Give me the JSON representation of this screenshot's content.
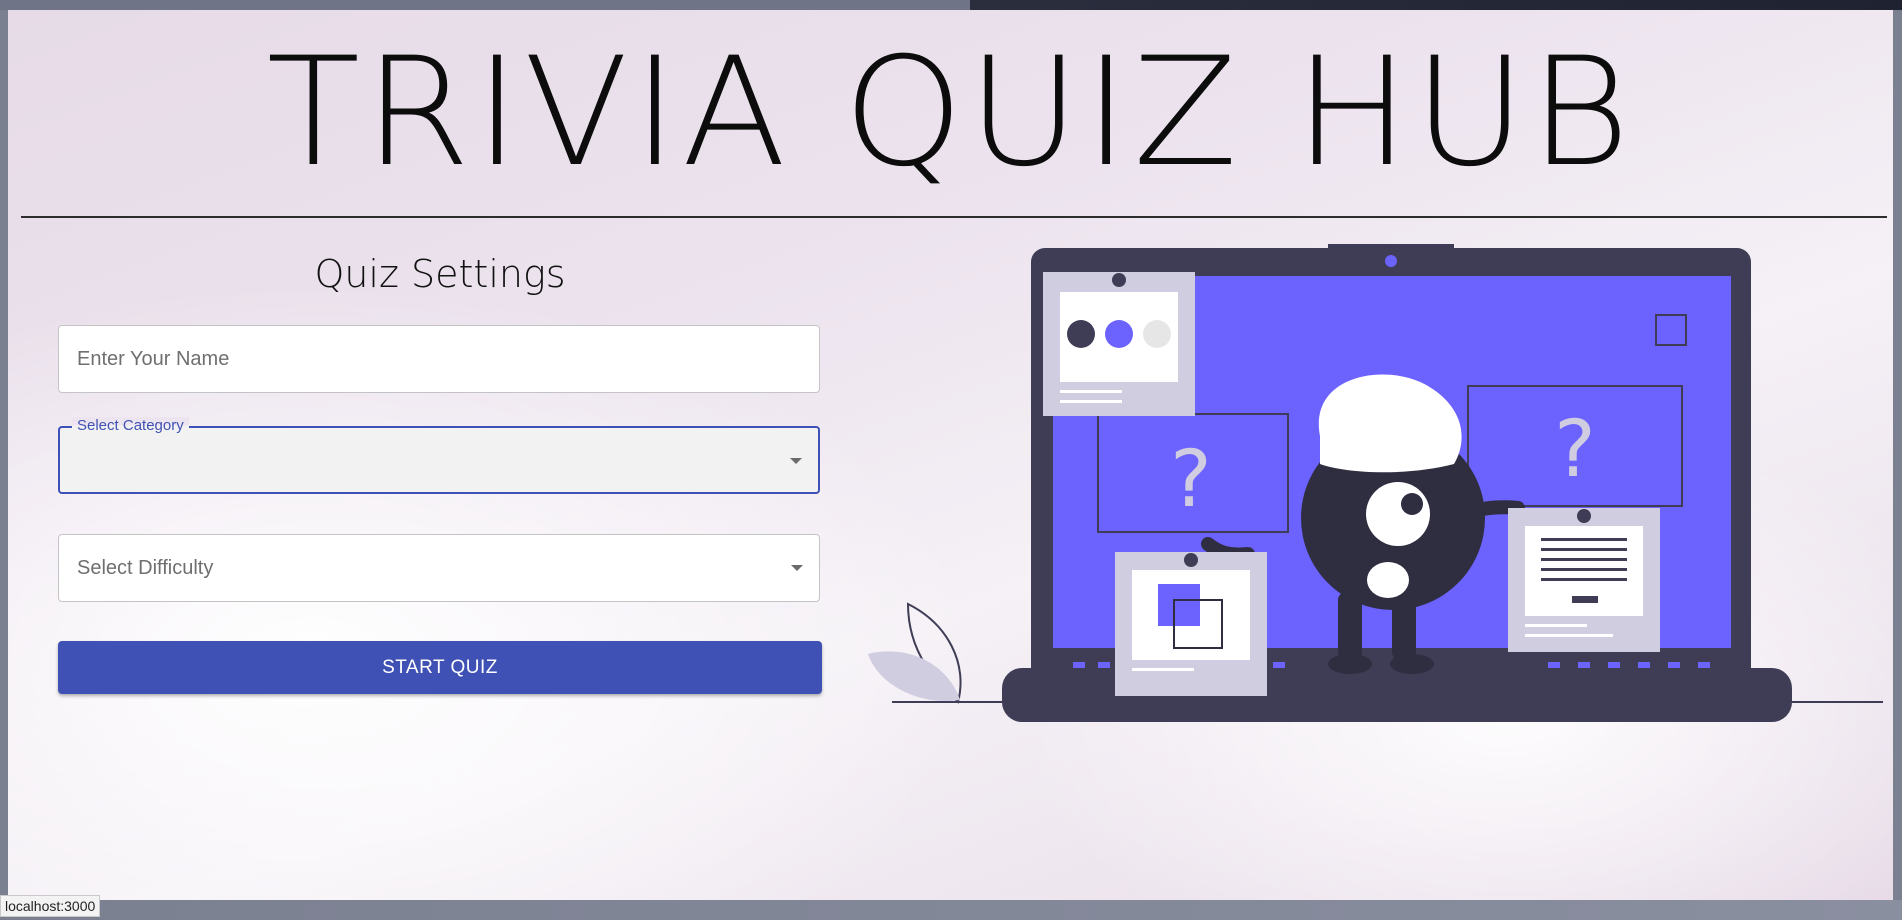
{
  "app": {
    "title": "TRIVIA QUIZ HUB"
  },
  "settings": {
    "heading": "Quiz Settings",
    "name_placeholder": "Enter Your Name",
    "category_label": "Select Category",
    "category_value": "",
    "difficulty_placeholder": "Select Difficulty",
    "start_label": "START QUIZ"
  },
  "illustration": {
    "question_mark_left": "?",
    "question_mark_right": "?"
  },
  "colors": {
    "primary": "#3f51b5",
    "laptop_dark": "#3f3d56",
    "screen": "#6c63ff",
    "card": "#d0cde1"
  },
  "status_bar": {
    "url": "localhost:3000"
  }
}
